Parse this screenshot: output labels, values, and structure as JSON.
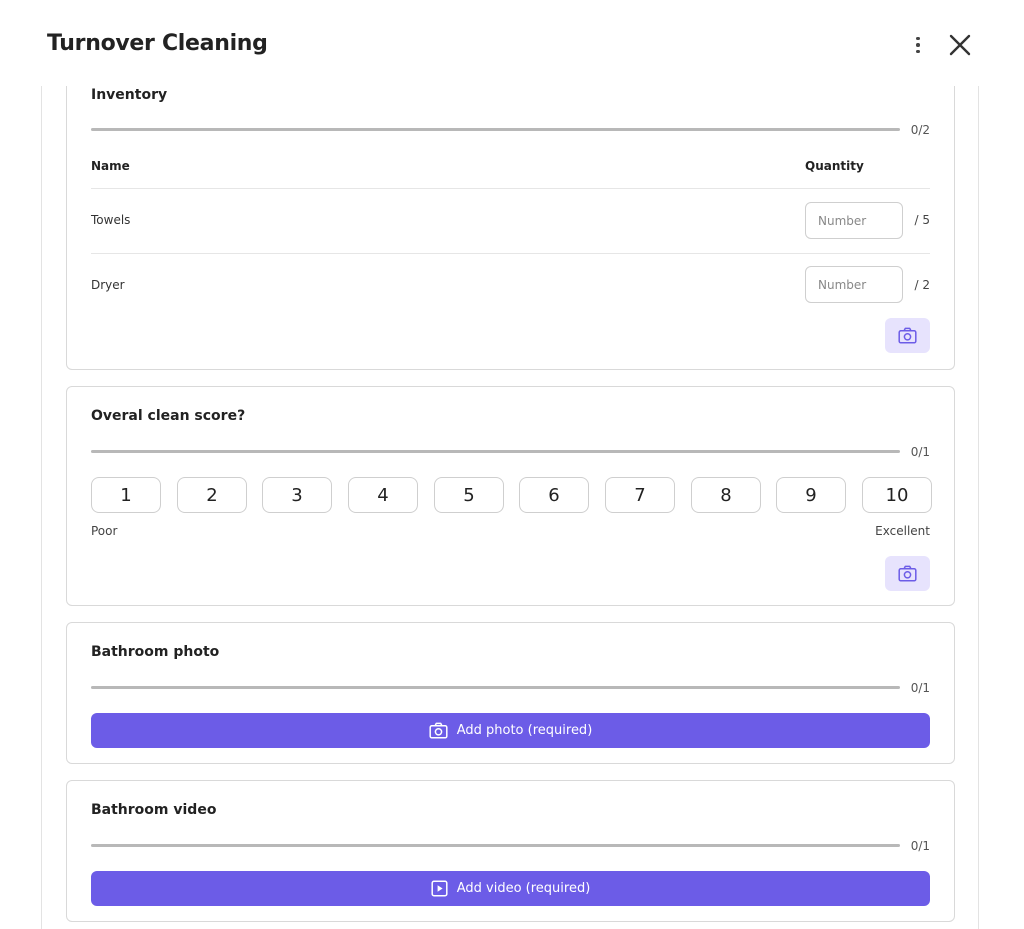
{
  "header": {
    "title": "Turnover Cleaning",
    "menu_icon": "more-vertical-icon",
    "close_icon": "close-icon"
  },
  "colors": {
    "accent": "#6c5ce7",
    "accent_light": "#e7e3fd",
    "track": "#b8b8b8"
  },
  "inventory": {
    "title": "Inventory",
    "progress": {
      "done": 0,
      "total": 2,
      "label": "0/2"
    },
    "columns": {
      "name": "Name",
      "quantity": "Quantity"
    },
    "rows": [
      {
        "name": "Towels",
        "value": "",
        "placeholder": "Number",
        "max_label": "/ 5"
      },
      {
        "name": "Dryer",
        "value": "",
        "placeholder": "Number",
        "max_label": "/ 2"
      }
    ],
    "camera_icon": "camera-icon"
  },
  "score": {
    "title": "Overal clean score?",
    "progress": {
      "done": 0,
      "total": 1,
      "label": "0/1"
    },
    "options": [
      "1",
      "2",
      "3",
      "4",
      "5",
      "6",
      "7",
      "8",
      "9",
      "10"
    ],
    "low_label": "Poor",
    "high_label": "Excellent",
    "camera_icon": "camera-icon"
  },
  "bathroom_photo": {
    "title": "Bathroom photo",
    "progress": {
      "done": 0,
      "total": 1,
      "label": "0/1"
    },
    "button_label": "Add photo (required)",
    "button_icon": "camera-icon"
  },
  "bathroom_video": {
    "title": "Bathroom video",
    "progress": {
      "done": 0,
      "total": 1,
      "label": "0/1"
    },
    "button_label": "Add video (required)",
    "button_icon": "video-play-icon"
  }
}
